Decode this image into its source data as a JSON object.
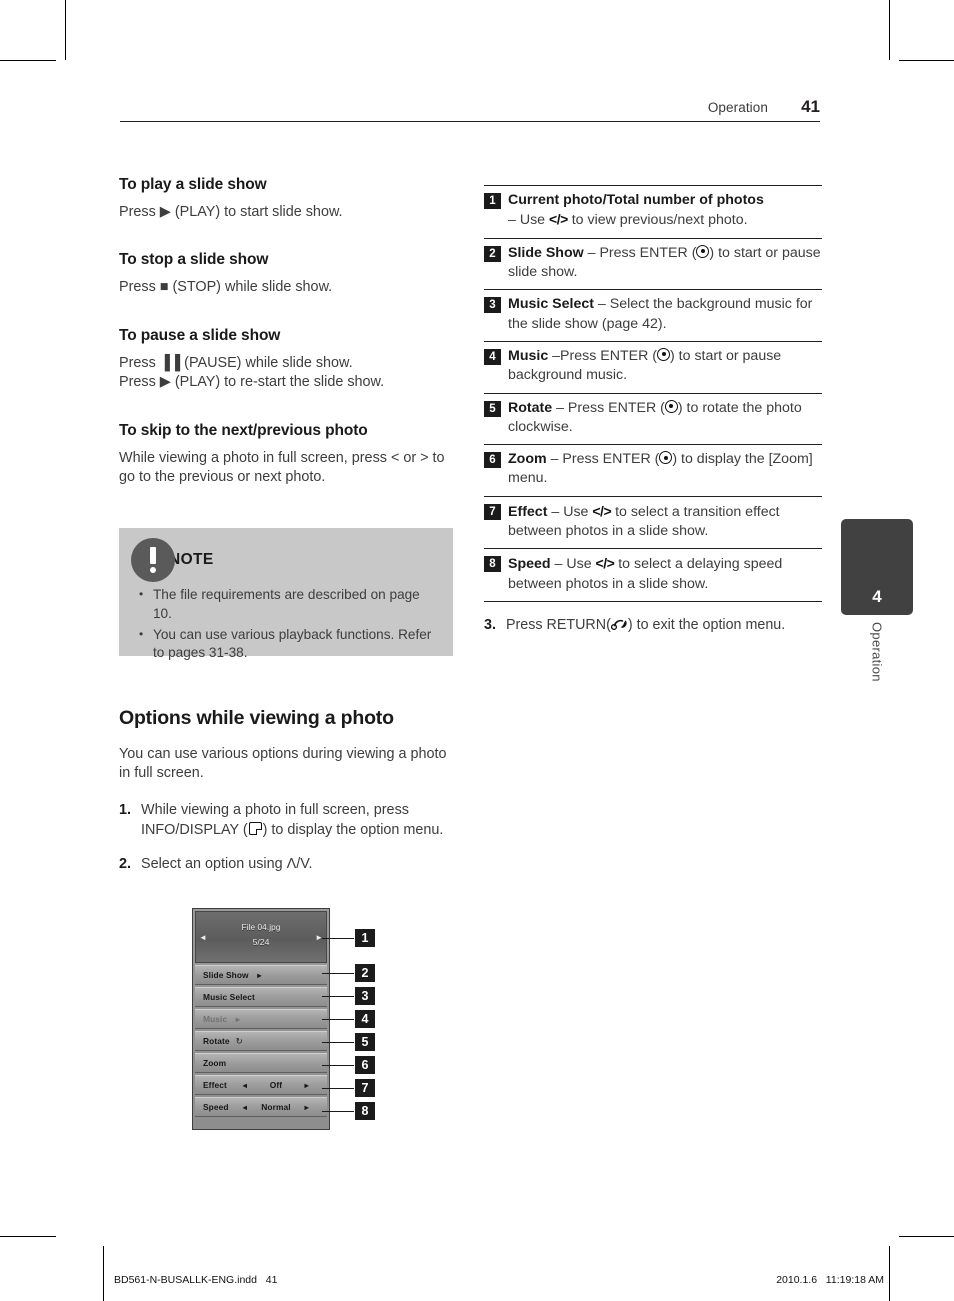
{
  "header": {
    "section": "Operation",
    "page_number": "41"
  },
  "left_column": {
    "sections": [
      {
        "heading": "To play a slide show",
        "lines": [
          "Press ▶ (PLAY) to start slide show."
        ]
      },
      {
        "heading": "To stop a slide show",
        "lines": [
          "Press ■ (STOP) while slide show."
        ]
      },
      {
        "heading": "To pause a slide show",
        "lines": [
          "Press ▐▐ (PAUSE) while slide show.",
          "Press ▶ (PLAY) to re-start the slide show."
        ]
      },
      {
        "heading": "To skip to the next/previous photo",
        "lines": [
          "While viewing a photo in full screen, press < or > to go to the previous or next photo."
        ]
      }
    ]
  },
  "note": {
    "icon": "exclamation-circle-icon",
    "title": "NOTE",
    "bullet": "•",
    "items": [
      "The file requirements are described on page 10.",
      "You can use various playback functions. Refer to pages 31-38."
    ]
  },
  "options_section": {
    "heading": "Options while viewing a photo",
    "intro": "You can use various options during viewing a photo in full screen.",
    "steps": [
      {
        "num": "1.",
        "text_before": "While viewing a photo in full screen, press INFO/DISPLAY (",
        "icon": "info-display-icon",
        "text_after": ") to display the option menu."
      },
      {
        "num": "2.",
        "text_before": "Select an option using Λ/V.",
        "icon": "",
        "text_after": ""
      }
    ]
  },
  "osd_figure": {
    "file_name": "File 04.jpg",
    "file_count": "5/24",
    "left_arrow": "◄",
    "right_arrow": "►",
    "rows": [
      {
        "label": "Slide Show",
        "play_icon": "►",
        "value": "",
        "dim": false,
        "has_arrows": false,
        "rotate_icon": ""
      },
      {
        "label": "Music Select",
        "play_icon": "",
        "value": "",
        "dim": false,
        "has_arrows": false,
        "rotate_icon": ""
      },
      {
        "label": "Music",
        "play_icon": "►",
        "value": "",
        "dim": true,
        "has_arrows": false,
        "rotate_icon": ""
      },
      {
        "label": "Rotate",
        "play_icon": "",
        "value": "",
        "dim": false,
        "has_arrows": false,
        "rotate_icon": "↻"
      },
      {
        "label": "Zoom",
        "play_icon": "",
        "value": "",
        "dim": false,
        "has_arrows": false,
        "rotate_icon": ""
      },
      {
        "label": "Effect",
        "play_icon": "",
        "value": "Off",
        "dim": false,
        "has_arrows": true,
        "rotate_icon": ""
      },
      {
        "label": "Speed",
        "play_icon": "",
        "value": "Normal",
        "dim": false,
        "has_arrows": true,
        "rotate_icon": ""
      }
    ],
    "callouts": [
      "1",
      "2",
      "3",
      "4",
      "5",
      "6",
      "7",
      "8"
    ]
  },
  "right_column": {
    "items": [
      {
        "badge": "1",
        "bold": "Current photo/Total number of photos",
        "rest": "",
        "line2_pre": "– Use ",
        "line2_arrows": "</>",
        "line2_post": " to view previous/next photo."
      },
      {
        "badge": "2",
        "bold": "Slide Show",
        "rest": " – Press ENTER (",
        "after_icon": ") to start or pause slide show.",
        "icon": "enter-icon"
      },
      {
        "badge": "3",
        "bold": "Music Select",
        "rest": " – Select the background music for the slide show (page 42).",
        "after_icon": "",
        "icon": ""
      },
      {
        "badge": "4",
        "bold": "Music",
        "rest": " –Press ENTER (",
        "after_icon": ") to start or pause background music.",
        "icon": "enter-icon"
      },
      {
        "badge": "5",
        "bold": "Rotate",
        "rest": " – Press ENTER (",
        "after_icon": ") to rotate the photo clockwise.",
        "icon": "enter-icon"
      },
      {
        "badge": "6",
        "bold": "Zoom",
        "rest": " – Press ENTER (",
        "after_icon": ") to display the [Zoom] menu.",
        "icon": "enter-icon"
      },
      {
        "badge": "7",
        "bold": "Effect",
        "rest": " – Use ",
        "arrows": "</>",
        "after_icon": " to select a transition effect between photos in a slide show.",
        "icon": ""
      },
      {
        "badge": "8",
        "bold": "Speed",
        "rest": " – Use ",
        "arrows": "</>",
        "after_icon": " to select a delaying speed between photos in a slide show.",
        "icon": ""
      }
    ],
    "step3": {
      "num": "3.",
      "text_before": "Press RETURN(",
      "icon": "return-icon",
      "text_after": ") to exit the option menu."
    }
  },
  "side_tab": {
    "number": "4",
    "label": "Operation"
  },
  "footer": {
    "file": "BD561-N-BUSALLK-ENG.indd   41",
    "timestamp": "2010.1.6   11:19:18 AM"
  },
  "colors": {
    "note_bg": "#c8c8c8",
    "badge_bg": "#1b1b1b",
    "tab_bg": "#414141",
    "text": "#3d3d3d"
  }
}
